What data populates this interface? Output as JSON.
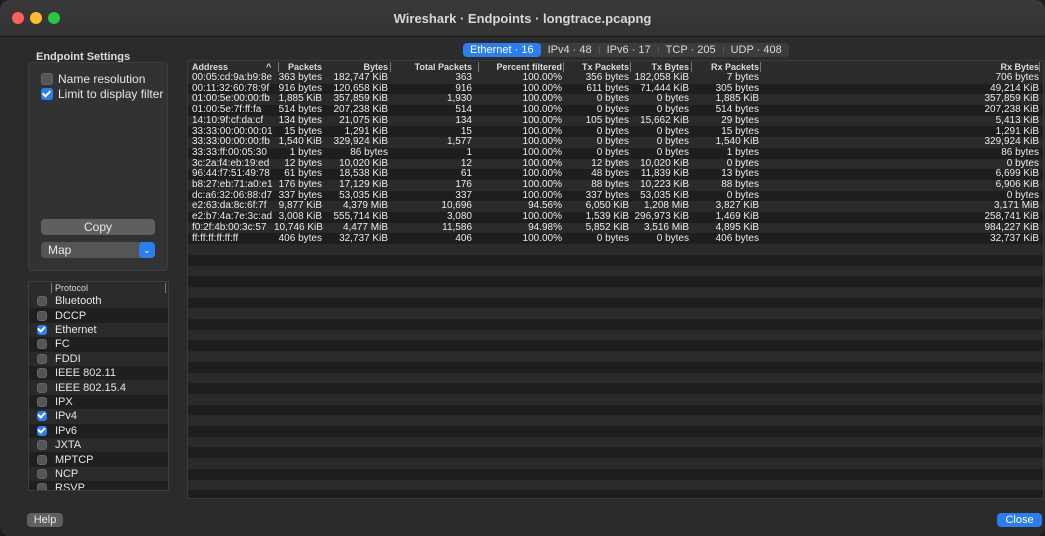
{
  "window": {
    "title": "Wireshark · Endpoints · longtrace.pcapng"
  },
  "settings": {
    "label": "Endpoint Settings",
    "name_resolution": {
      "label": "Name resolution",
      "checked": false
    },
    "limit_filter": {
      "label": "Limit to display filter",
      "checked": true
    },
    "copy_label": "Copy",
    "map_label": "Map"
  },
  "protocols": {
    "header": "Protocol",
    "items": [
      {
        "label": "Bluetooth",
        "checked": false
      },
      {
        "label": "DCCP",
        "checked": false
      },
      {
        "label": "Ethernet",
        "checked": true
      },
      {
        "label": "FC",
        "checked": false
      },
      {
        "label": "FDDI",
        "checked": false
      },
      {
        "label": "IEEE 802.11",
        "checked": false
      },
      {
        "label": "IEEE 802.15.4",
        "checked": false
      },
      {
        "label": "IPX",
        "checked": false
      },
      {
        "label": "IPv4",
        "checked": true
      },
      {
        "label": "IPv6",
        "checked": true
      },
      {
        "label": "JXTA",
        "checked": false
      },
      {
        "label": "MPTCP",
        "checked": false
      },
      {
        "label": "NCP",
        "checked": false
      },
      {
        "label": "RSVP",
        "checked": false
      }
    ]
  },
  "tabs": [
    {
      "label": "Ethernet · 16",
      "active": true
    },
    {
      "label": "IPv4 · 48",
      "active": false
    },
    {
      "label": "IPv6 · 17",
      "active": false
    },
    {
      "label": "TCP · 205",
      "active": false
    },
    {
      "label": "UDP · 408",
      "active": false
    }
  ],
  "table": {
    "headers": [
      "Address",
      "Packets",
      "Bytes",
      "Total Packets",
      "Percent filtered",
      "Tx Packets",
      "Tx Bytes",
      "Rx Packets",
      "Rx Bytes"
    ],
    "sort_indicator": "^",
    "rows": [
      [
        "00:05:cd:9a:b9:8e",
        "363 bytes",
        "182,747 KiB",
        "363",
        "100.00%",
        "356 bytes",
        "182,058 KiB",
        "7 bytes",
        "706 bytes"
      ],
      [
        "00:11:32:60:78:9f",
        "916 bytes",
        "120,658 KiB",
        "916",
        "100.00%",
        "611 bytes",
        "71,444 KiB",
        "305 bytes",
        "49,214 KiB"
      ],
      [
        "01:00:5e:00:00:fb",
        "1,885 KiB",
        "357,859 KiB",
        "1,930",
        "100.00%",
        "0 bytes",
        "0 bytes",
        "1,885 KiB",
        "357,859 KiB"
      ],
      [
        "01:00:5e:7f:ff:fa",
        "514 bytes",
        "207,238 KiB",
        "514",
        "100.00%",
        "0 bytes",
        "0 bytes",
        "514 bytes",
        "207,238 KiB"
      ],
      [
        "14:10:9f:cf:da:cf",
        "134 bytes",
        "21,075 KiB",
        "134",
        "100.00%",
        "105 bytes",
        "15,662 KiB",
        "29 bytes",
        "5,413 KiB"
      ],
      [
        "33:33:00:00:00:01",
        "15 bytes",
        "1,291 KiB",
        "15",
        "100.00%",
        "0 bytes",
        "0 bytes",
        "15 bytes",
        "1,291 KiB"
      ],
      [
        "33:33:00:00:00:fb",
        "1,540 KiB",
        "329,924 KiB",
        "1,577",
        "100.00%",
        "0 bytes",
        "0 bytes",
        "1,540 KiB",
        "329,924 KiB"
      ],
      [
        "33:33:ff:00:05:30",
        "1 bytes",
        "86 bytes",
        "1",
        "100.00%",
        "0 bytes",
        "0 bytes",
        "1 bytes",
        "86 bytes"
      ],
      [
        "3c:2a:f4:eb:19:ed",
        "12 bytes",
        "10,020 KiB",
        "12",
        "100.00%",
        "12 bytes",
        "10,020 KiB",
        "0 bytes",
        "0 bytes"
      ],
      [
        "96:44:f7:51:49:78",
        "61 bytes",
        "18,538 KiB",
        "61",
        "100.00%",
        "48 bytes",
        "11,839 KiB",
        "13 bytes",
        "6,699 KiB"
      ],
      [
        "b8:27:eb:71:a0:e1",
        "176 bytes",
        "17,129 KiB",
        "176",
        "100.00%",
        "88 bytes",
        "10,223 KiB",
        "88 bytes",
        "6,906 KiB"
      ],
      [
        "dc:a6:32:06:88:d7",
        "337 bytes",
        "53,035 KiB",
        "337",
        "100.00%",
        "337 bytes",
        "53,035 KiB",
        "0 bytes",
        "0 bytes"
      ],
      [
        "e2:63:da:8c:6f:7f",
        "9,877 KiB",
        "4,379 MiB",
        "10,696",
        "94.56%",
        "6,050 KiB",
        "1,208 MiB",
        "3,827 KiB",
        "3,171 MiB"
      ],
      [
        "e2:b7:4a:7e:3c:ad",
        "3,008 KiB",
        "555,714 KiB",
        "3,080",
        "100.00%",
        "1,539 KiB",
        "296,973 KiB",
        "1,469 KiB",
        "258,741 KiB"
      ],
      [
        "f0:2f:4b:00:3c:57",
        "10,746 KiB",
        "4,477 MiB",
        "11,586",
        "94.98%",
        "5,852 KiB",
        "3,516 MiB",
        "4,895 KiB",
        "984,227 KiB"
      ],
      [
        "ff:ff:ff:ff:ff:ff",
        "406 bytes",
        "32,737 KiB",
        "406",
        "100.00%",
        "0 bytes",
        "0 bytes",
        "406 bytes",
        "32,737 KiB"
      ]
    ]
  },
  "buttons": {
    "help": "Help",
    "close": "Close"
  }
}
